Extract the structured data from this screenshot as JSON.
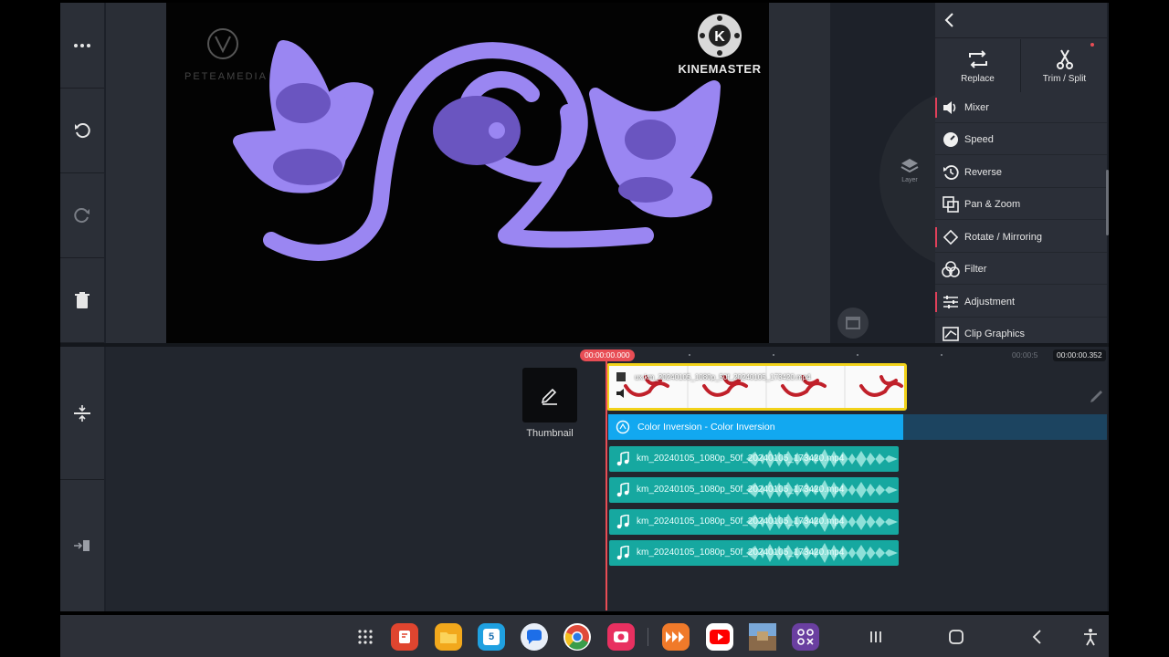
{
  "left_toolbar": {
    "items": [
      {
        "name": "more-icon",
        "glyph": "⋯"
      },
      {
        "name": "undo-icon",
        "glyph": "↶"
      },
      {
        "name": "redo-icon",
        "glyph": "↷"
      },
      {
        "name": "delete-icon",
        "glyph": "🗑"
      }
    ],
    "bottom_items": [
      "align-tracks-icon",
      "export-icon"
    ]
  },
  "preview": {
    "watermark_right": "KINEMASTER",
    "watermark_left": "PETEAMEDIA"
  },
  "right_panel": {
    "top_buttons": [
      {
        "label": "Replace",
        "icon": "replace-icon"
      },
      {
        "label": "Trim / Split",
        "icon": "scissors-icon"
      }
    ],
    "menu": [
      {
        "label": "Mixer",
        "icon": "speaker-icon",
        "marked": true
      },
      {
        "label": "Speed",
        "icon": "speedometer-icon",
        "marked": false
      },
      {
        "label": "Reverse",
        "icon": "reverse-icon",
        "marked": false
      },
      {
        "label": "Pan & Zoom",
        "icon": "pan-zoom-icon",
        "marked": false
      },
      {
        "label": "Rotate / Mirroring",
        "icon": "rotate-icon",
        "marked": true
      },
      {
        "label": "Filter",
        "icon": "filter-icon",
        "marked": false
      },
      {
        "label": "Adjustment",
        "icon": "sliders-icon",
        "marked": true
      },
      {
        "label": "Clip Graphics",
        "icon": "clip-graphics-icon",
        "marked": false
      }
    ],
    "layer_label": "Layer"
  },
  "timeline": {
    "current_time": "00:00:00.000",
    "mid_time": "00:00:5",
    "end_time": "00:00:00.352",
    "thumbnail_label": "Thumbnail",
    "video_clip_name": "ux.km_20240105_1080p_50f_20240105_173420.mp4",
    "effect_clip_label": "Color Inversion - Color Inversion",
    "audio_tracks": [
      "km_20240105_1080p_50f_20240105_173420.mp4",
      "km_20240105_1080p_50f_20240105_173420.mp4",
      "km_20240105_1080p_50f_20240105_173420.mp4",
      "km_20240105_1080p_50f_20240105_173420.mp4"
    ]
  },
  "taskbar": {
    "apps": [
      {
        "name": "app-drawer-icon",
        "color": "#2d3038"
      },
      {
        "name": "notes-app-icon",
        "color": "#e0452f"
      },
      {
        "name": "files-app-icon",
        "color": "#f2a81c"
      },
      {
        "name": "calendar-app-icon",
        "color": "#1fa0e0",
        "label": "5"
      },
      {
        "name": "messages-app-icon",
        "color": "#e8eef8"
      },
      {
        "name": "chrome-app-icon",
        "color": "#ffffff"
      },
      {
        "name": "screen-recorder-app-icon",
        "color": "#e83060"
      },
      {
        "name": "kinemaster-app-icon",
        "color": "#f07a2a"
      },
      {
        "name": "youtube-app-icon",
        "color": "#ffffff"
      },
      {
        "name": "gallery-app-icon",
        "color": "#5a8ac0"
      },
      {
        "name": "multi-app-icon",
        "color": "#6a3fa0"
      }
    ],
    "nav": [
      "recent-apps-icon",
      "home-icon",
      "back-icon",
      "accessibility-icon"
    ]
  }
}
